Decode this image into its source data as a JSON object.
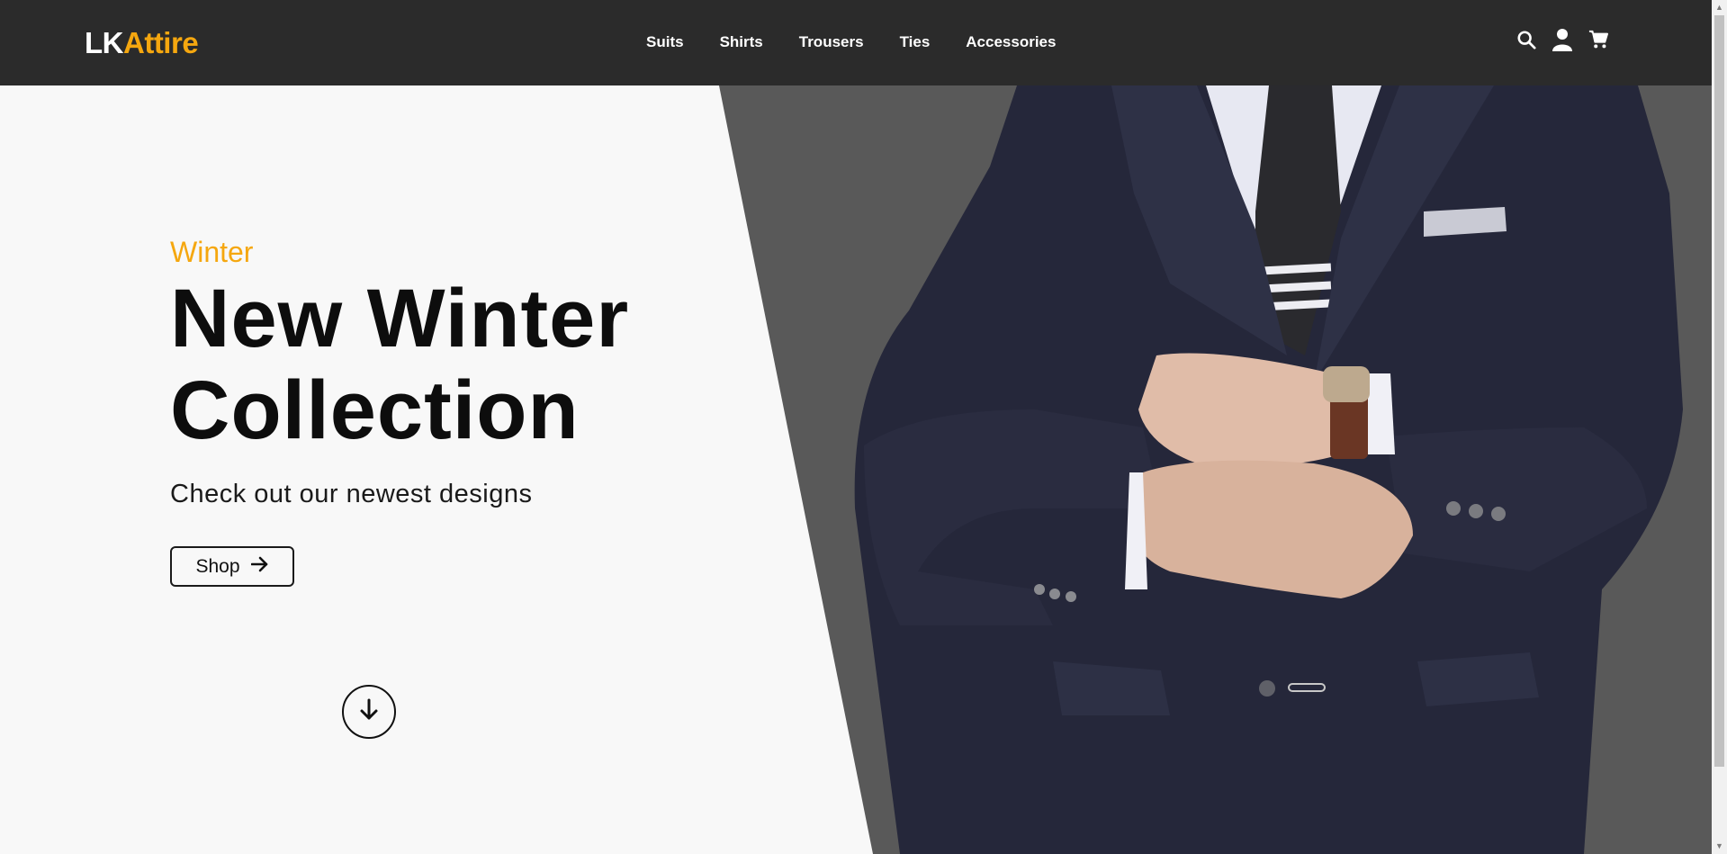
{
  "header": {
    "logo_part1": "LK",
    "logo_part2": "Attire",
    "nav": [
      {
        "label": "Suits"
      },
      {
        "label": "Shirts"
      },
      {
        "label": "Trousers"
      },
      {
        "label": "Ties"
      },
      {
        "label": "Accessories"
      }
    ],
    "icons": [
      "search-icon",
      "user-icon",
      "cart-icon"
    ]
  },
  "hero": {
    "eyebrow": "Winter",
    "title_line1": "New Winter",
    "title_line2": "Collection",
    "subtitle": "Check out our newest designs",
    "button_label": "Shop",
    "button_icon": "arrow-right-icon",
    "scroll_icon": "arrow-down-icon",
    "image": "man-in-navy-suit-checking-wristwatch"
  },
  "colors": {
    "header_bg": "#2b2b2b",
    "accent": "#f5a70f",
    "hero_bg": "#f8f8f8",
    "image_bg": "#595959",
    "text": "#0d0d0d"
  }
}
